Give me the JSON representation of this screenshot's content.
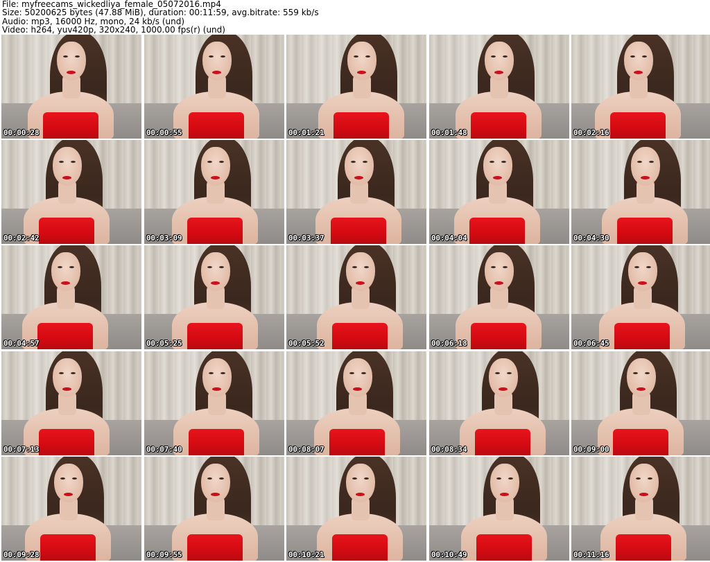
{
  "header": {
    "line1": "File: myfreecams_wickedliya_female_05072016.mp4",
    "line2": "Size: 50200625 bytes (47.88 MiB), duration: 00:11:59, avg.bitrate: 559 kb/s",
    "line3": "Audio: mp3, 16000 Hz, mono, 24 kb/s (und)",
    "line4": "Video: h264, yuv420p, 320x240, 1000.00 fps(r) (und)"
  },
  "thumbnails": [
    {
      "timestamp": "00:00:28"
    },
    {
      "timestamp": "00:00:55"
    },
    {
      "timestamp": "00:01:21"
    },
    {
      "timestamp": "00:01:48"
    },
    {
      "timestamp": "00:02:16"
    },
    {
      "timestamp": "00:02:42"
    },
    {
      "timestamp": "00:03:09"
    },
    {
      "timestamp": "00:03:37"
    },
    {
      "timestamp": "00:04:04"
    },
    {
      "timestamp": "00:04:30"
    },
    {
      "timestamp": "00:04:57"
    },
    {
      "timestamp": "00:05:25"
    },
    {
      "timestamp": "00:05:52"
    },
    {
      "timestamp": "00:06:18"
    },
    {
      "timestamp": "00:06:45"
    },
    {
      "timestamp": "00:07:13"
    },
    {
      "timestamp": "00:07:40"
    },
    {
      "timestamp": "00:08:07"
    },
    {
      "timestamp": "00:08:34"
    },
    {
      "timestamp": "00:09:00"
    },
    {
      "timestamp": "00:09:28"
    },
    {
      "timestamp": "00:09:55"
    },
    {
      "timestamp": "00:10:21"
    },
    {
      "timestamp": "00:10:49"
    },
    {
      "timestamp": "00:11:16"
    }
  ],
  "colors": {
    "background": "#ffffff",
    "dress": "#e8141c",
    "hair": "#4a3226",
    "timestamp_text": "#ffffff"
  }
}
